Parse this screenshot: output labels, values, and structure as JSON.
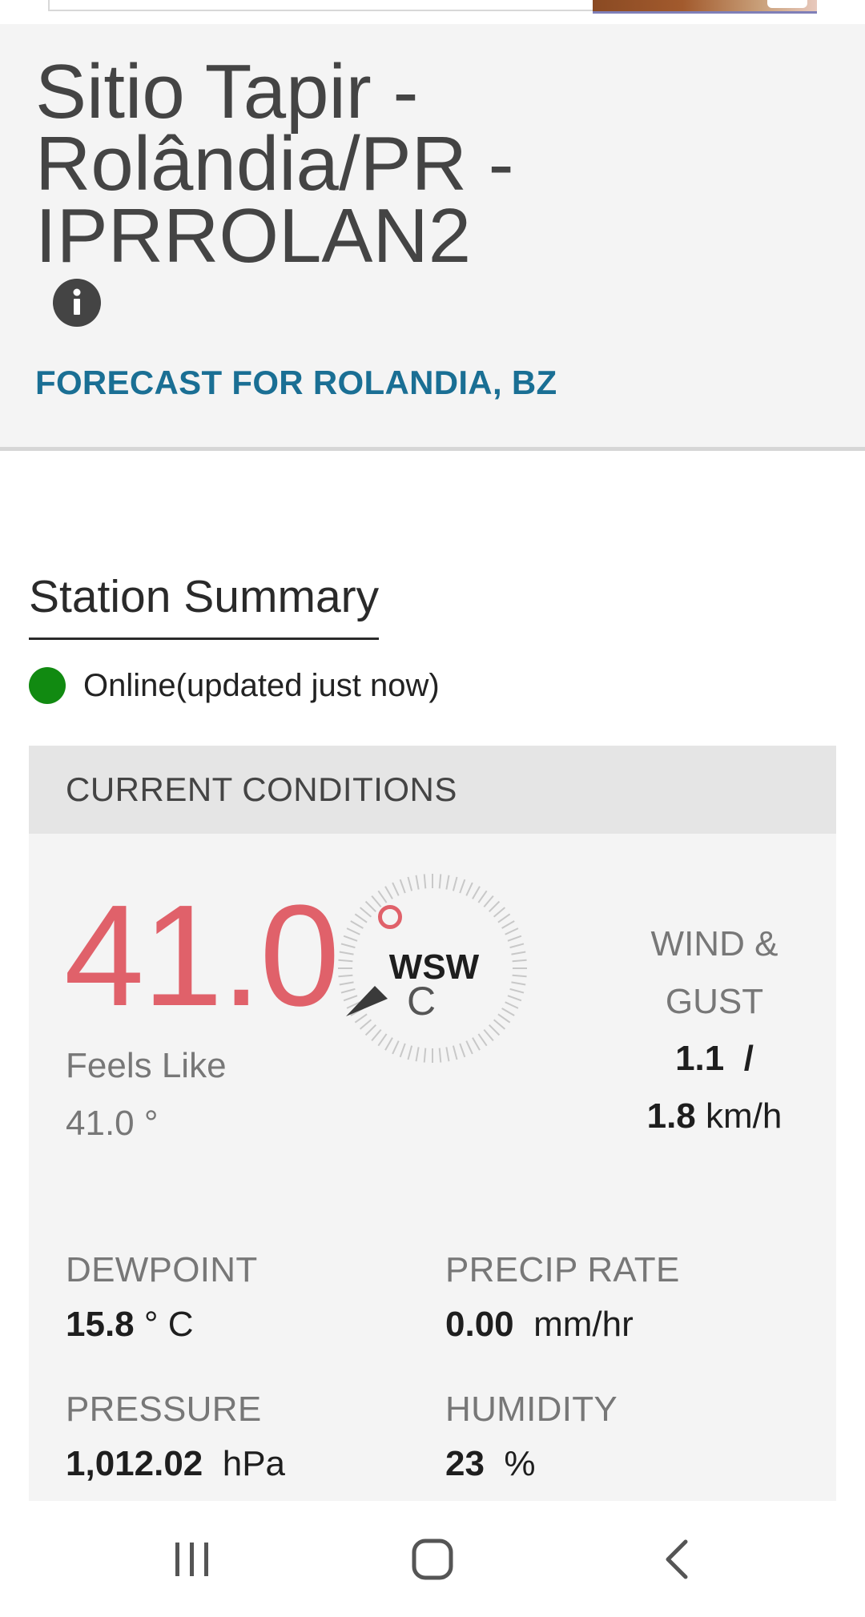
{
  "header": {
    "station_title": "Sitio Tapir - Rolândia/PR - IPRROLAN2",
    "info_icon": "info-icon",
    "forecast_link": "FORECAST FOR ROLANDIA, BZ"
  },
  "summary": {
    "tab_label": "Station Summary",
    "status_text": "Online(updated just now)",
    "status_color": "#118a11"
  },
  "current_conditions": {
    "heading": "CURRENT CONDITIONS",
    "temperature": "41.0",
    "temperature_unit": "C",
    "temperature_color": "#e0616a",
    "wind_direction": "WSW",
    "feels_like_label": "Feels Like",
    "feels_like_value": "41.0 °",
    "wind_label_line1": "WIND &",
    "wind_label_line2": "GUST",
    "wind_speed": "1.1",
    "wind_separator": "/",
    "wind_gust": "1.8",
    "wind_unit": "km/h",
    "dewpoint_label": "DEWPOINT",
    "dewpoint_value": "15.8",
    "dewpoint_unit": "° C",
    "precip_label": "PRECIP RATE",
    "precip_value": "0.00",
    "precip_unit": "mm/hr",
    "pressure_label": "PRESSURE",
    "pressure_value": "1,012.02",
    "pressure_unit": "hPa",
    "humidity_label": "HUMIDITY",
    "humidity_value": "23",
    "humidity_unit": "%"
  },
  "nav_bar": {
    "recents_icon": "recent-apps-icon",
    "home_icon": "home-icon",
    "back_icon": "back-icon"
  }
}
